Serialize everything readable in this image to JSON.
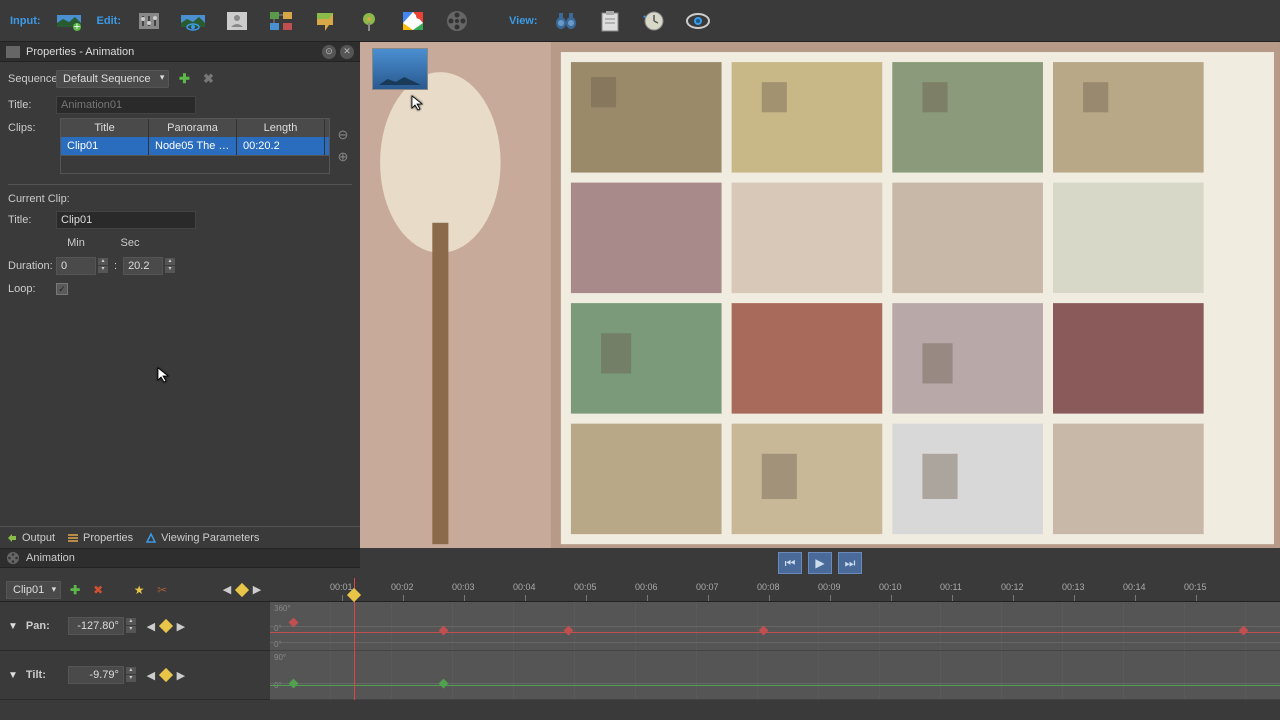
{
  "toolbar": {
    "input_label": "Input:",
    "edit_label": "Edit:",
    "view_label": "View:"
  },
  "panel": {
    "title": "Properties - Animation",
    "sequence_label": "Sequence:",
    "sequence_value": "Default Sequence",
    "title_label": "Title:",
    "title_placeholder": "Animation01",
    "clips_label": "Clips:",
    "columns": {
      "title": "Title",
      "panorama": "Panorama",
      "length": "Length"
    },
    "clip_row": {
      "title": "Clip01",
      "panorama": "Node05 The Do...",
      "length": "00:20.2"
    },
    "current_clip_label": "Current Clip:",
    "clip_title_label": "Title:",
    "clip_title_value": "Clip01",
    "min_label": "Min",
    "sec_label": "Sec",
    "duration_label": "Duration:",
    "duration_min": "0",
    "duration_sec": "20.2",
    "loop_label": "Loop:",
    "tabs": {
      "output": "Output",
      "properties": "Properties",
      "viewing": "Viewing Parameters"
    }
  },
  "anim": {
    "header": "Animation",
    "clip_select": "Clip01",
    "tracks": {
      "pan": {
        "label": "Pan:",
        "value": "-127.80°"
      },
      "tilt": {
        "label": "Tilt:",
        "value": "-9.79°"
      }
    },
    "ruler": [
      "00:01",
      "00:02",
      "00:03",
      "00:04",
      "00:05",
      "00:06",
      "00:07",
      "00:08",
      "00:09",
      "00:10",
      "00:11",
      "00:12",
      "00:13",
      "00:14",
      "00:15"
    ],
    "pan_axis": [
      "360°",
      "0°",
      "0°"
    ],
    "tilt_axis": [
      "90°",
      "0°"
    ]
  }
}
